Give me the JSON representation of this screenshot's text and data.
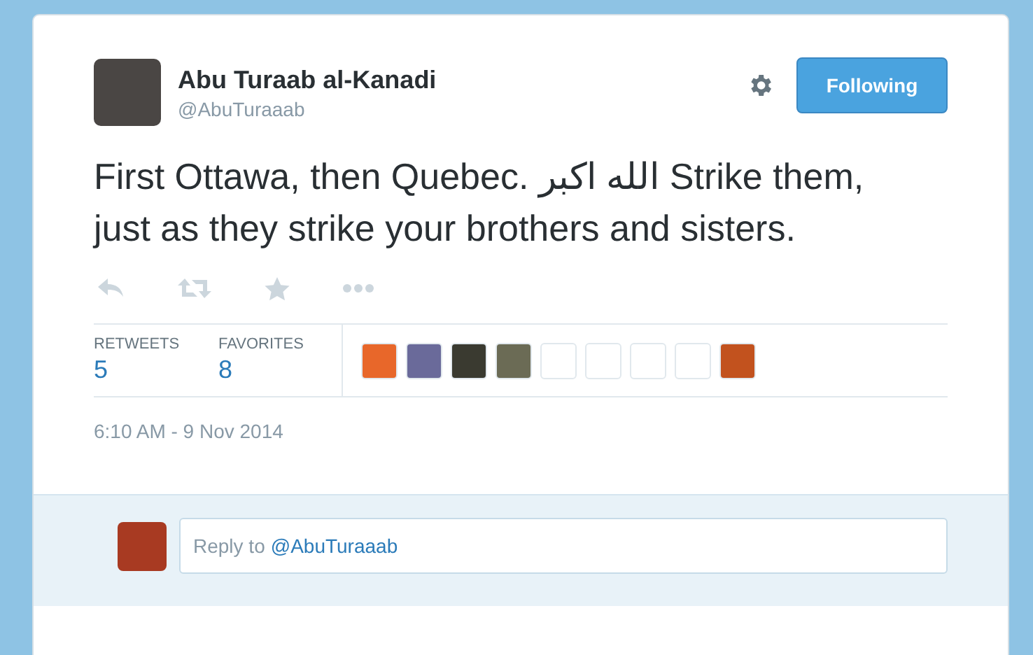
{
  "author": {
    "name": "Abu Turaab al-Kanadi",
    "handle": "@AbuTuraaab"
  },
  "follow_button": {
    "label": "Following",
    "selected": true
  },
  "tweet_text": "First Ottawa, then Quebec. الله اكبر Strike them, just as they strike your brothers and sisters.",
  "stats": [
    {
      "label": "RETWEETS",
      "value": "5"
    },
    {
      "label": "FAVORITES",
      "value": "8"
    }
  ],
  "timestamp": "6:10 AM - 9 Nov 2014",
  "reply": {
    "prefix": "Reply to",
    "mention": "@AbuTuraaab"
  }
}
